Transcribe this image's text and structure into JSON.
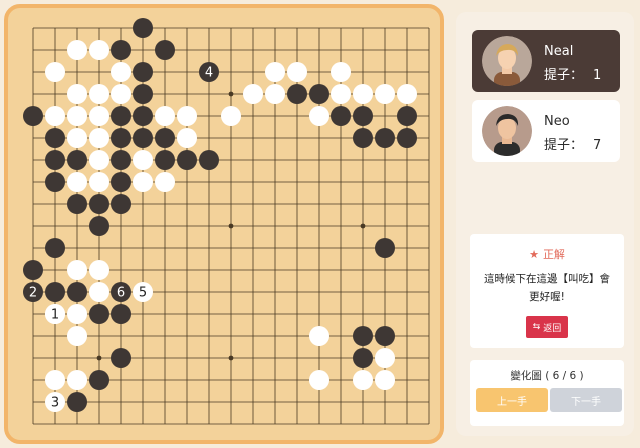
{
  "board": {
    "size": 19,
    "colors": {
      "board": "#f3d29a",
      "line": "#4a3a24",
      "black": "#3e3734",
      "white": "#ffffff"
    },
    "hoshi": [
      [
        3,
        3
      ],
      [
        9,
        3
      ],
      [
        15,
        3
      ],
      [
        3,
        9
      ],
      [
        9,
        9
      ],
      [
        15,
        9
      ],
      [
        3,
        15
      ],
      [
        9,
        15
      ],
      [
        15,
        15
      ]
    ],
    "black": [
      [
        5,
        0
      ],
      [
        4,
        1
      ],
      [
        6,
        1
      ],
      [
        5,
        2
      ],
      [
        5,
        3
      ],
      [
        12,
        3
      ],
      [
        13,
        3
      ],
      [
        0,
        4
      ],
      [
        4,
        4
      ],
      [
        5,
        4
      ],
      [
        14,
        4
      ],
      [
        15,
        4
      ],
      [
        17,
        4
      ],
      [
        1,
        5
      ],
      [
        4,
        5
      ],
      [
        5,
        5
      ],
      [
        6,
        5
      ],
      [
        15,
        5
      ],
      [
        16,
        5
      ],
      [
        17,
        5
      ],
      [
        1,
        6
      ],
      [
        2,
        6
      ],
      [
        4,
        6
      ],
      [
        6,
        6
      ],
      [
        7,
        6
      ],
      [
        8,
        6
      ],
      [
        1,
        7
      ],
      [
        4,
        7
      ],
      [
        2,
        8
      ],
      [
        3,
        8
      ],
      [
        4,
        8
      ],
      [
        3,
        9
      ],
      [
        1,
        10
      ],
      [
        16,
        10
      ],
      [
        0,
        11
      ],
      [
        1,
        12
      ],
      [
        2,
        12
      ],
      [
        3,
        13
      ],
      [
        4,
        13
      ],
      [
        15,
        14
      ],
      [
        16,
        14
      ],
      [
        4,
        15
      ],
      [
        15,
        15
      ],
      [
        3,
        16
      ],
      [
        2,
        17
      ]
    ],
    "white": [
      [
        2,
        1
      ],
      [
        3,
        1
      ],
      [
        1,
        2
      ],
      [
        4,
        2
      ],
      [
        11,
        2
      ],
      [
        12,
        2
      ],
      [
        14,
        2
      ],
      [
        2,
        3
      ],
      [
        3,
        3
      ],
      [
        4,
        3
      ],
      [
        10,
        3
      ],
      [
        11,
        3
      ],
      [
        14,
        3
      ],
      [
        15,
        3
      ],
      [
        16,
        3
      ],
      [
        17,
        3
      ],
      [
        1,
        4
      ],
      [
        2,
        4
      ],
      [
        3,
        4
      ],
      [
        6,
        4
      ],
      [
        7,
        4
      ],
      [
        9,
        4
      ],
      [
        13,
        4
      ],
      [
        2,
        5
      ],
      [
        3,
        5
      ],
      [
        7,
        5
      ],
      [
        3,
        6
      ],
      [
        5,
        6
      ],
      [
        2,
        7
      ],
      [
        3,
        7
      ],
      [
        5,
        7
      ],
      [
        6,
        7
      ],
      [
        2,
        11
      ],
      [
        3,
        11
      ],
      [
        3,
        12
      ],
      [
        1,
        13
      ],
      [
        2,
        13
      ],
      [
        2,
        14
      ],
      [
        13,
        14
      ],
      [
        16,
        15
      ],
      [
        1,
        16
      ],
      [
        2,
        16
      ],
      [
        13,
        16
      ],
      [
        15,
        16
      ],
      [
        16,
        16
      ]
    ],
    "labels": [
      {
        "x": 8,
        "y": 2,
        "color": "black",
        "text": "4"
      },
      {
        "x": 0,
        "y": 12,
        "color": "black",
        "text": "2"
      },
      {
        "x": 4,
        "y": 12,
        "color": "black",
        "text": "6"
      },
      {
        "x": 5,
        "y": 12,
        "color": "white",
        "text": "5"
      },
      {
        "x": 1,
        "y": 13,
        "color": "white",
        "text": "1"
      },
      {
        "x": 1,
        "y": 17,
        "color": "white",
        "text": "3"
      }
    ]
  },
  "players": [
    {
      "name": "Neal",
      "captures_label": "提子：",
      "captures": "1",
      "avatar": "avatar-blond"
    },
    {
      "name": "Neo",
      "captures_label": "提子：",
      "captures": "7",
      "avatar": "avatar-darkhair"
    }
  ],
  "hint": {
    "icon": "star-icon",
    "title": "正解",
    "text": "這時候下在這邊【叫吃】會更好喔!",
    "back_label": "返回",
    "back_icon": "swap-icon"
  },
  "variation": {
    "label": "變化圖 ( 6 / 6 )",
    "prev_label": "上一手",
    "next_label": "下一手"
  }
}
